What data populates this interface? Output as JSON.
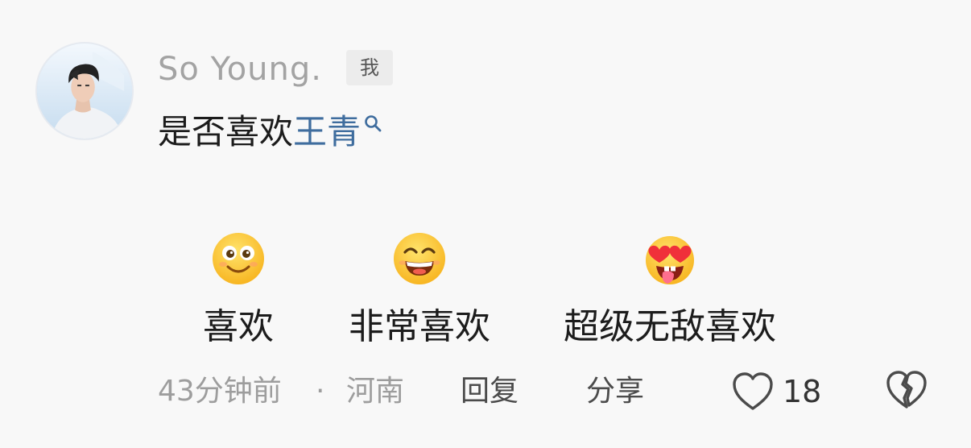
{
  "comment": {
    "author": "So  Young.",
    "author_badge": "我",
    "text_prefix": "是否喜欢",
    "text_link": "王青",
    "reactions": [
      {
        "emoji": "smile-face",
        "label": "喜欢"
      },
      {
        "emoji": "grin-face",
        "label": "非常喜欢"
      },
      {
        "emoji": "heart-eyes-face",
        "label": "超级无敌喜欢"
      }
    ],
    "time": "43分钟前",
    "separator": "·",
    "location": "河南",
    "reply_label": "回复",
    "share_label": "分享",
    "like_count": "18"
  },
  "colors": {
    "link": "#3f6d9e",
    "muted": "#9d9d9d",
    "text": "#1c1c1c"
  }
}
